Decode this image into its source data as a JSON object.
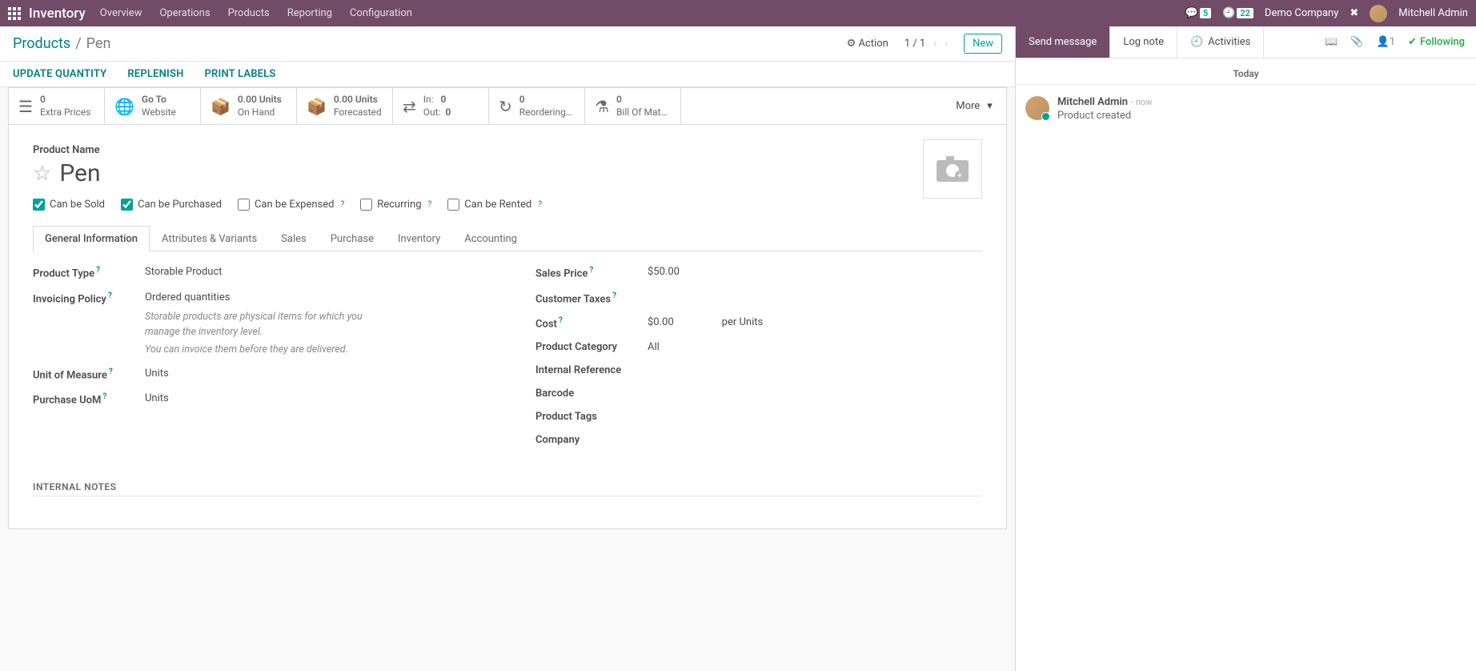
{
  "nav": {
    "brand": "Inventory",
    "items": [
      "Overview",
      "Operations",
      "Products",
      "Reporting",
      "Configuration"
    ],
    "msg_count": "5",
    "clock_count": "22",
    "company": "Demo Company",
    "user": "Mitchell Admin"
  },
  "header": {
    "bc_root": "Products",
    "bc_current": "Pen",
    "action": "Action",
    "pager": "1 / 1",
    "new": "New"
  },
  "cmds": {
    "upd": "UPDATE QUANTITY",
    "rep": "REPLENISH",
    "print": "PRINT LABELS"
  },
  "stats": {
    "extra_top": "0",
    "extra": "Extra Prices",
    "goto_top": "Go To",
    "goto": "Website",
    "onhand_top": "0.00 Units",
    "onhand": "On Hand",
    "fc_top": "0.00 Units",
    "fc": "Forecasted",
    "in": "In:",
    "in_v": "0",
    "out": "Out:",
    "out_v": "0",
    "reord_top": "0",
    "reord": "Reordering…",
    "bom_top": "0",
    "bom": "Bill Of Mat…",
    "more": "More"
  },
  "product": {
    "name_lbl": "Product Name",
    "name": "Pen",
    "checks": {
      "sold": "Can be Sold",
      "purch": "Can be Purchased",
      "exp": "Can be Expensed",
      "rec": "Recurring",
      "rent": "Can be Rented"
    }
  },
  "tabs": [
    "General Information",
    "Attributes & Variants",
    "Sales",
    "Purchase",
    "Inventory",
    "Accounting"
  ],
  "fields": {
    "left": {
      "ptype_l": "Product Type",
      "ptype_v": "Storable Product",
      "inv_l": "Invoicing Policy",
      "inv_v": "Ordered quantities",
      "note1": "Storable products are physical items for which you manage the inventory level.",
      "note2": "You can invoice them before they are delivered.",
      "uom_l": "Unit of Measure",
      "uom_v": "Units",
      "puom_l": "Purchase UoM",
      "puom_v": "Units"
    },
    "right": {
      "price_l": "Sales Price",
      "price_v": "$50.00",
      "tax_l": "Customer Taxes",
      "tax_v": "",
      "cost_l": "Cost",
      "cost_v": "$0.00",
      "cost_suffix": "per Units",
      "cat_l": "Product Category",
      "cat_v": "All",
      "ref_l": "Internal Reference",
      "ref_v": "",
      "bar_l": "Barcode",
      "bar_v": "",
      "tags_l": "Product Tags",
      "tags_v": "",
      "comp_l": "Company",
      "comp_v": ""
    },
    "notes_h": "INTERNAL NOTES"
  },
  "chat": {
    "send": "Send message",
    "log": "Log note",
    "act": "Activities",
    "follow_count": "1",
    "following": "Following",
    "today": "Today",
    "author": "Mitchell Admin",
    "ago": "now",
    "msg": "Product created"
  }
}
